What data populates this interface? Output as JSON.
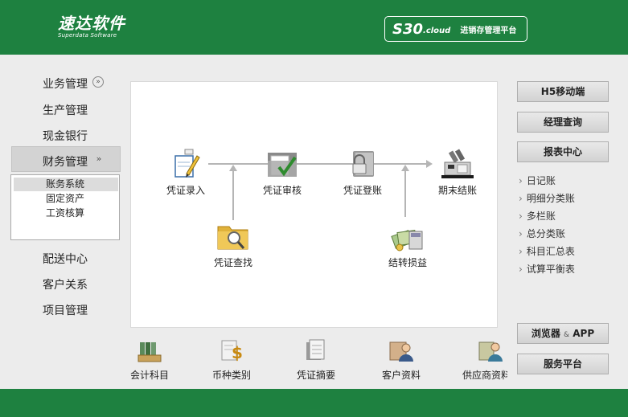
{
  "header": {
    "brand_name": "速达软件",
    "brand_sub": "Superdata Software",
    "product_code": "S30",
    "product_suffix": ".cloud",
    "product_tag": "进销存管理平台"
  },
  "nav": {
    "items": [
      {
        "label": "业务管理"
      },
      {
        "label": "生产管理"
      },
      {
        "label": "现金银行"
      },
      {
        "label": "财务管理"
      },
      {
        "label": "配送中心"
      },
      {
        "label": "客户关系"
      },
      {
        "label": "项目管理"
      }
    ],
    "submenu": [
      {
        "label": "账务系统"
      },
      {
        "label": "固定资产"
      },
      {
        "label": "工资核算"
      }
    ]
  },
  "flow": {
    "nodes": [
      {
        "label": "凭证录入",
        "icon": "pen-paper-icon"
      },
      {
        "label": "凭证审核",
        "icon": "folder-check-icon"
      },
      {
        "label": "凭证登账",
        "icon": "lock-book-icon"
      },
      {
        "label": "期末结账",
        "icon": "cash-register-icon"
      },
      {
        "label": "凭证查找",
        "icon": "folder-search-icon"
      },
      {
        "label": "结转损益",
        "icon": "money-calculator-icon"
      }
    ]
  },
  "shortcuts": [
    {
      "label": "会计科目",
      "icon": "binders-icon"
    },
    {
      "label": "币种类别",
      "icon": "currency-icon"
    },
    {
      "label": "凭证摘要",
      "icon": "document-stack-icon"
    },
    {
      "label": "客户资料",
      "icon": "customer-card-icon"
    },
    {
      "label": "供应商资料",
      "icon": "supplier-icon"
    }
  ],
  "right": {
    "buttons_top": [
      {
        "label": "H5移动端"
      },
      {
        "label": "经理查询"
      },
      {
        "label": "报表中心"
      }
    ],
    "reports": [
      {
        "label": "日记账"
      },
      {
        "label": "明细分类账"
      },
      {
        "label": "多栏账"
      },
      {
        "label": "总分类账"
      },
      {
        "label": "科目汇总表"
      },
      {
        "label": "试算平衡表"
      }
    ],
    "browser_label": "浏览器",
    "browser_amp": "&",
    "browser_app": "APP",
    "service_label": "服务平台"
  },
  "colors": {
    "brand": "#1e8140",
    "panel_bg": "#ececec"
  }
}
